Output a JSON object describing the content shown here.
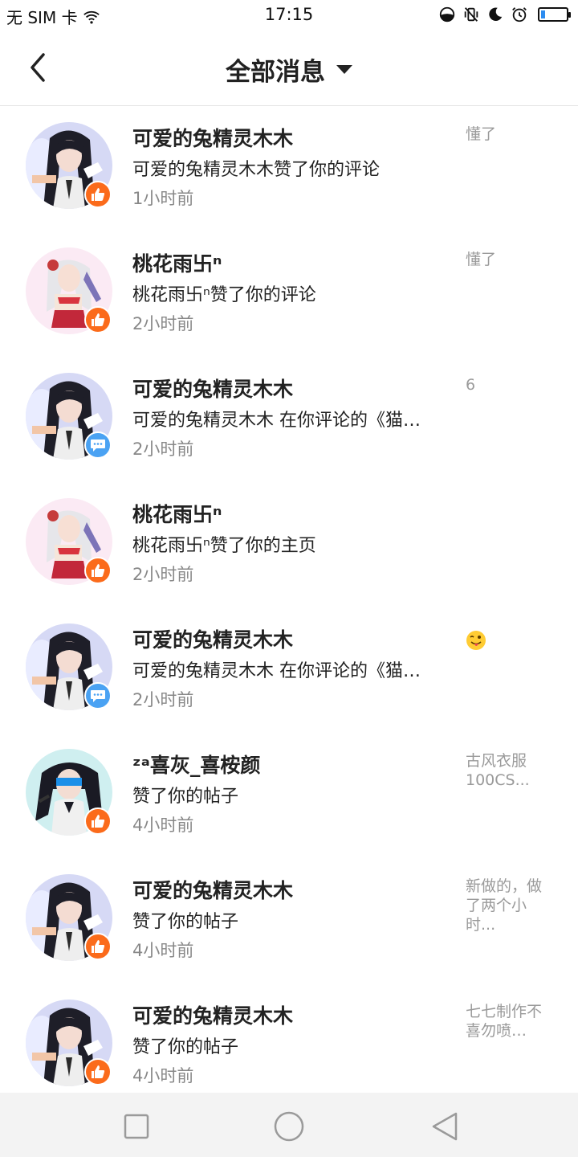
{
  "status_bar": {
    "carrier": "无 SIM 卡",
    "time": "17:15",
    "icons": [
      "wifi-icon",
      "data-saver-icon",
      "vibrate-icon",
      "moon-icon",
      "alarm-icon",
      "battery-icon"
    ],
    "battery_level": 0.15
  },
  "header": {
    "title": "全部消息",
    "back_icon": "chevron-left-icon",
    "dropdown_icon": "caret-down-icon"
  },
  "messages": [
    {
      "name": "可爱的兔精灵木木",
      "action": "可爱的兔精灵木木赞了你的评论",
      "time": "1小时前",
      "preview": "懂了",
      "badge": "like",
      "avatar": "dark-haired-girl"
    },
    {
      "name": "桃花雨卐ⁿ",
      "action": "桃花雨卐ⁿ赞了你的评论",
      "time": "2小时前",
      "preview": "懂了",
      "badge": "like",
      "avatar": "silver-haired-girl"
    },
    {
      "name": "可爱的兔精灵木木",
      "action": "可爱的兔精灵木木 在你评论的《猫…",
      "time": "2小时前",
      "preview": "6",
      "badge": "comment",
      "avatar": "dark-haired-girl"
    },
    {
      "name": "桃花雨卐ⁿ",
      "action": "桃花雨卐ⁿ赞了你的主页",
      "time": "2小时前",
      "preview": "",
      "badge": "like",
      "avatar": "silver-haired-girl"
    },
    {
      "name": "可爱的兔精灵木木",
      "action": "可爱的兔精灵木木 在你评论的《猫…",
      "time": "2小时前",
      "preview": "",
      "preview_emoji": "tongue-wink-emoji",
      "badge": "comment",
      "avatar": "dark-haired-girl"
    },
    {
      "name": "ᶻᵃ喜灰_喜桉颜",
      "action": "赞了你的帖子",
      "time": "4小时前",
      "preview": "古风衣服100CS...",
      "badge": "like",
      "avatar": "visor-girl"
    },
    {
      "name": "可爱的兔精灵木木",
      "action": "赞了你的帖子",
      "time": "4小时前",
      "preview": "新做的，做了两个小时...",
      "badge": "like",
      "avatar": "dark-haired-girl"
    },
    {
      "name": "可爱的兔精灵木木",
      "action": "赞了你的帖子",
      "time": "4小时前",
      "preview": "七七制作不喜勿喷…",
      "badge": "like",
      "avatar": "dark-haired-girl"
    }
  ],
  "nav_bar": {
    "icons": [
      "recent-apps-icon",
      "home-icon",
      "back-icon"
    ]
  },
  "colors": {
    "like_badge": "#fb6b1b",
    "comment_badge": "#4aa2f3",
    "secondary_text": "#888888"
  }
}
